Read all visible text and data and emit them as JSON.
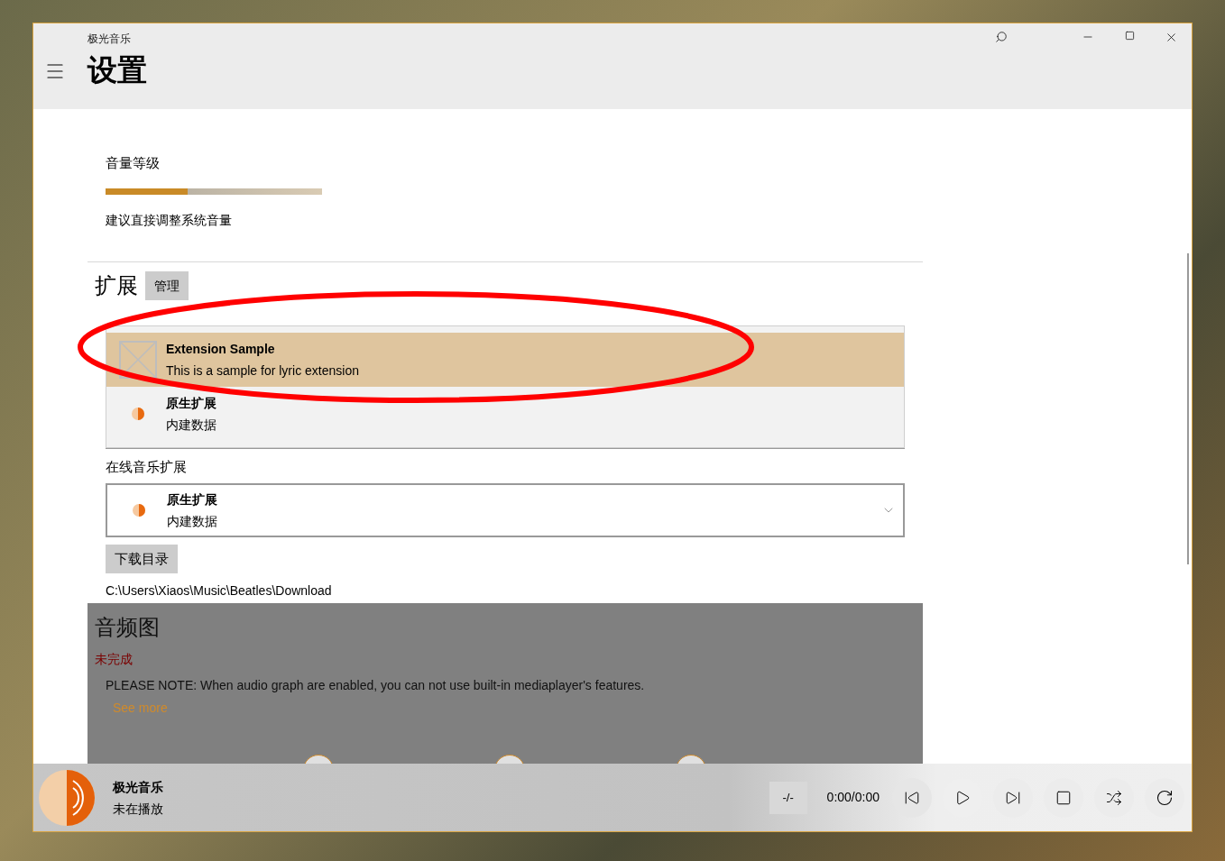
{
  "window": {
    "app_name": "极光音乐",
    "title": "设置"
  },
  "volume": {
    "label": "音量等级",
    "level": 0.38,
    "hint": "建议直接调整系统音量"
  },
  "extensions": {
    "heading": "扩展",
    "manage_button": "管理",
    "lyric_dropdown": {
      "expanded": true,
      "options": [
        {
          "name": "Extension Sample",
          "description": "This is a sample for lyric extension",
          "kind": "placeholder",
          "selected": true
        },
        {
          "name": "原生扩展",
          "description": "内建数据",
          "kind": "native",
          "selected": false
        }
      ]
    },
    "online_label": "在线音乐扩展",
    "online_dropdown": {
      "name": "原生扩展",
      "description": "内建数据",
      "kind": "native"
    },
    "download_button": "下载目录",
    "download_path": "C:\\Users\\Xiaos\\Music\\Beatles\\Download"
  },
  "audio_graph": {
    "heading": "音频图",
    "status": "未完成",
    "note": "PLEASE NOTE: When audio graph are enabled, you can not use built-in mediaplayer's features.",
    "link": "See more"
  },
  "player": {
    "title": "极光音乐",
    "subtitle": "未在播放",
    "rate_button": "-/-",
    "time": "0:00/0:00"
  }
}
